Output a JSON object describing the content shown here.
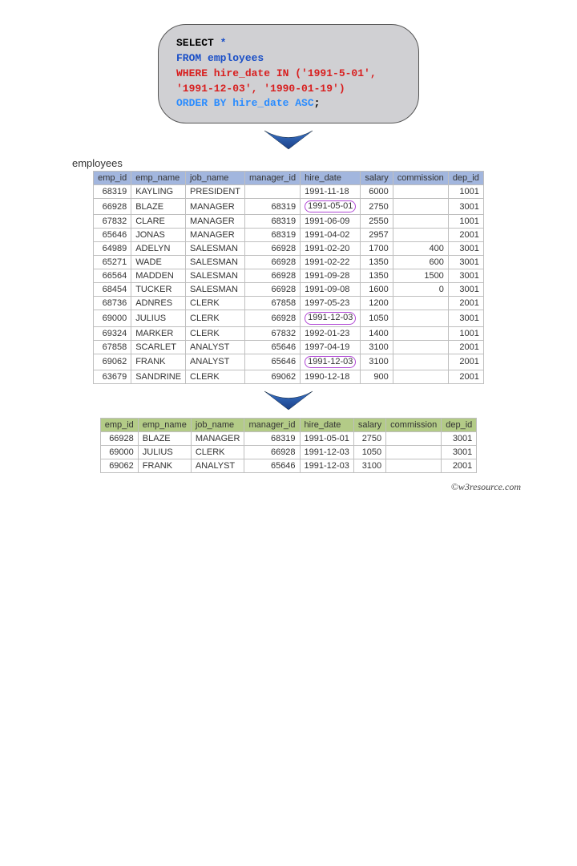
{
  "sql": {
    "line1a": "SELECT ",
    "line1b": "*",
    "line2a": "FROM ",
    "line2b": "employees",
    "line3": "WHERE hire_date IN ('1991-5-01',",
    "line4": "'1991-12-03', '1990-01-19')",
    "line5": "ORDER BY hire_date ASC",
    "line5b": ";"
  },
  "table1_title": "employees",
  "headers": [
    "emp_id",
    "emp_name",
    "job_name",
    "manager_id",
    "hire_date",
    "salary",
    "commission",
    "dep_id"
  ],
  "employees": [
    {
      "emp_id": "68319",
      "emp_name": "KAYLING",
      "job_name": "PRESIDENT",
      "manager_id": "",
      "hire_date": "1991-11-18",
      "salary": "6000",
      "commission": "",
      "dep_id": "1001",
      "hl": false
    },
    {
      "emp_id": "66928",
      "emp_name": "BLAZE",
      "job_name": "MANAGER",
      "manager_id": "68319",
      "hire_date": "1991-05-01",
      "salary": "2750",
      "commission": "",
      "dep_id": "3001",
      "hl": true
    },
    {
      "emp_id": "67832",
      "emp_name": "CLARE",
      "job_name": "MANAGER",
      "manager_id": "68319",
      "hire_date": "1991-06-09",
      "salary": "2550",
      "commission": "",
      "dep_id": "1001",
      "hl": false
    },
    {
      "emp_id": "65646",
      "emp_name": "JONAS",
      "job_name": "MANAGER",
      "manager_id": "68319",
      "hire_date": "1991-04-02",
      "salary": "2957",
      "commission": "",
      "dep_id": "2001",
      "hl": false
    },
    {
      "emp_id": "64989",
      "emp_name": "ADELYN",
      "job_name": "SALESMAN",
      "manager_id": "66928",
      "hire_date": "1991-02-20",
      "salary": "1700",
      "commission": "400",
      "dep_id": "3001",
      "hl": false
    },
    {
      "emp_id": "65271",
      "emp_name": "WADE",
      "job_name": "SALESMAN",
      "manager_id": "66928",
      "hire_date": "1991-02-22",
      "salary": "1350",
      "commission": "600",
      "dep_id": "3001",
      "hl": false
    },
    {
      "emp_id": "66564",
      "emp_name": "MADDEN",
      "job_name": "SALESMAN",
      "manager_id": "66928",
      "hire_date": "1991-09-28",
      "salary": "1350",
      "commission": "1500",
      "dep_id": "3001",
      "hl": false
    },
    {
      "emp_id": "68454",
      "emp_name": "TUCKER",
      "job_name": "SALESMAN",
      "manager_id": "66928",
      "hire_date": "1991-09-08",
      "salary": "1600",
      "commission": "0",
      "dep_id": "3001",
      "hl": false
    },
    {
      "emp_id": "68736",
      "emp_name": "ADNRES",
      "job_name": "CLERK",
      "manager_id": "67858",
      "hire_date": "1997-05-23",
      "salary": "1200",
      "commission": "",
      "dep_id": "2001",
      "hl": false
    },
    {
      "emp_id": "69000",
      "emp_name": "JULIUS",
      "job_name": "CLERK",
      "manager_id": "66928",
      "hire_date": "1991-12-03",
      "salary": "1050",
      "commission": "",
      "dep_id": "3001",
      "hl": true
    },
    {
      "emp_id": "69324",
      "emp_name": "MARKER",
      "job_name": "CLERK",
      "manager_id": "67832",
      "hire_date": "1992-01-23",
      "salary": "1400",
      "commission": "",
      "dep_id": "1001",
      "hl": false
    },
    {
      "emp_id": "67858",
      "emp_name": "SCARLET",
      "job_name": "ANALYST",
      "manager_id": "65646",
      "hire_date": "1997-04-19",
      "salary": "3100",
      "commission": "",
      "dep_id": "2001",
      "hl": false
    },
    {
      "emp_id": "69062",
      "emp_name": "FRANK",
      "job_name": "ANALYST",
      "manager_id": "65646",
      "hire_date": "1991-12-03",
      "salary": "3100",
      "commission": "",
      "dep_id": "2001",
      "hl": true
    },
    {
      "emp_id": "63679",
      "emp_name": "SANDRINE",
      "job_name": "CLERK",
      "manager_id": "69062",
      "hire_date": "1990-12-18",
      "salary": "900",
      "commission": "",
      "dep_id": "2001",
      "hl": false
    }
  ],
  "result": [
    {
      "emp_id": "66928",
      "emp_name": "BLAZE",
      "job_name": "MANAGER",
      "manager_id": "68319",
      "hire_date": "1991-05-01",
      "salary": "2750",
      "commission": "",
      "dep_id": "3001"
    },
    {
      "emp_id": "69000",
      "emp_name": "JULIUS",
      "job_name": "CLERK",
      "manager_id": "66928",
      "hire_date": "1991-12-03",
      "salary": "1050",
      "commission": "",
      "dep_id": "3001"
    },
    {
      "emp_id": "69062",
      "emp_name": "FRANK",
      "job_name": "ANALYST",
      "manager_id": "65646",
      "hire_date": "1991-12-03",
      "salary": "3100",
      "commission": "",
      "dep_id": "2001"
    }
  ],
  "watermark": "©w3resource.com"
}
